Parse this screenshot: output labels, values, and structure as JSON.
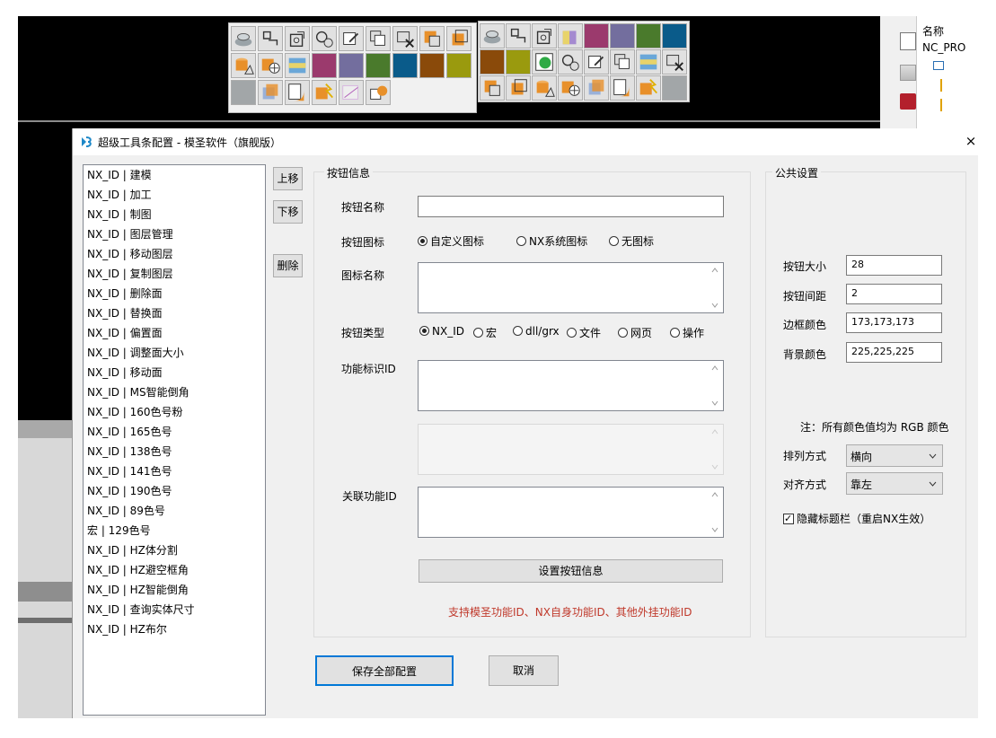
{
  "dialog": {
    "title": "超级工具条配置 - 模圣软件（旗舰版）",
    "close_label": "×"
  },
  "list": {
    "items": [
      "NX_ID | 建模",
      "NX_ID | 加工",
      "NX_ID | 制图",
      "NX_ID | 图层管理",
      "NX_ID | 移动图层",
      "NX_ID | 复制图层",
      "NX_ID | 删除面",
      "NX_ID | 替换面",
      "NX_ID | 偏置面",
      "NX_ID | 调整面大小",
      "NX_ID | 移动面",
      "NX_ID | MS智能倒角",
      "NX_ID | 160色号粉",
      "NX_ID | 165色号",
      "NX_ID | 138色号",
      "NX_ID | 141色号",
      "NX_ID | 190色号",
      "NX_ID | 89色号",
      "宏 | 129色号",
      "NX_ID | HZ体分割",
      "NX_ID | HZ避空框角",
      "NX_ID | HZ智能倒角",
      "NX_ID | 查询实体尺寸",
      "NX_ID | HZ布尔"
    ],
    "move_up_label": "上移",
    "move_down_label": "下移",
    "delete_label": "删除"
  },
  "button_info": {
    "group_title": "按钮信息",
    "name_label": "按钮名称",
    "name_value": "",
    "icon_label": "按钮图标",
    "icon_options": [
      "自定义图标",
      "NX系统图标",
      "无图标"
    ],
    "icon_selected": 0,
    "icon_name_label": "图标名称",
    "icon_name_value": "",
    "type_label": "按钮类型",
    "type_options": [
      "NX_ID",
      "宏",
      "dll/grx",
      "文件",
      "网页",
      "操作"
    ],
    "type_selected": 0,
    "func_id_label": "功能标识ID",
    "func_id_value": "",
    "related_id_label": "关联功能ID",
    "related_id_value": "",
    "set_button_label": "设置按钮信息",
    "support_note": "支持模圣功能ID、NX自身功能ID、其他外挂功能ID"
  },
  "public_settings": {
    "group_title": "公共设置",
    "size_label": "按钮大小",
    "size_value": "28",
    "spacing_label": "按钮间距",
    "spacing_value": "2",
    "border_color_label": "边框颜色",
    "border_color_value": "173,173,173",
    "bg_color_label": "背景颜色",
    "bg_color_value": "225,225,225",
    "color_note": "注：所有颜色值均为 RGB 颜色",
    "layout_label": "排列方式",
    "layout_value": "横向",
    "align_label": "对齐方式",
    "align_value": "靠左",
    "hide_title_label": "隐藏标题栏（重启NX生效）",
    "hide_title_checked": true
  },
  "footer": {
    "save_label": "保存全部配置",
    "cancel_label": "取消"
  },
  "background_app": {
    "panel_header": "名称",
    "panel_item": "NC_PRO",
    "toolbar_colors": {
      "magenta": "#9b3a6d",
      "purple": "#736e9e",
      "green": "#4a7a2c",
      "blue": "#0a5b8a",
      "brown": "#8a4a0a",
      "olive": "#9a9a0e",
      "gray": "#a2a6a8"
    },
    "toolbar1_icons": [
      "shell-icon",
      "sketch-icon",
      "revolve-icon",
      "gear-settings-icon",
      "edit-icon",
      "layers-icon",
      "delete-face-icon",
      "replace-face-icon",
      "offset-face-icon",
      "cylinder-icon",
      "move-face-icon",
      "colorize-icon",
      "color-magenta",
      "color-purple",
      "color-green",
      "color-blue",
      "color-brown",
      "color-olive",
      "color-gray",
      "box-icon",
      "chamfer-icon",
      "boolean-icon",
      "measure-icon",
      "split-icon"
    ],
    "toolbar2_icons": [
      "shell-icon",
      "sketch-icon",
      "revolve-icon",
      "sphere-icon",
      "color-magenta",
      "color-purple",
      "color-green",
      "color-blue",
      "color-brown",
      "color-olive",
      "sphere-color-icon",
      "gear-settings-icon",
      "edit-icon",
      "layers-icon",
      "colorize-icon",
      "delete-face-icon",
      "replace-face-icon",
      "offset-face-icon",
      "cylinder-icon",
      "move-face-icon",
      "box-icon",
      "chamfer-icon",
      "boolean-icon",
      "color-gray"
    ]
  }
}
